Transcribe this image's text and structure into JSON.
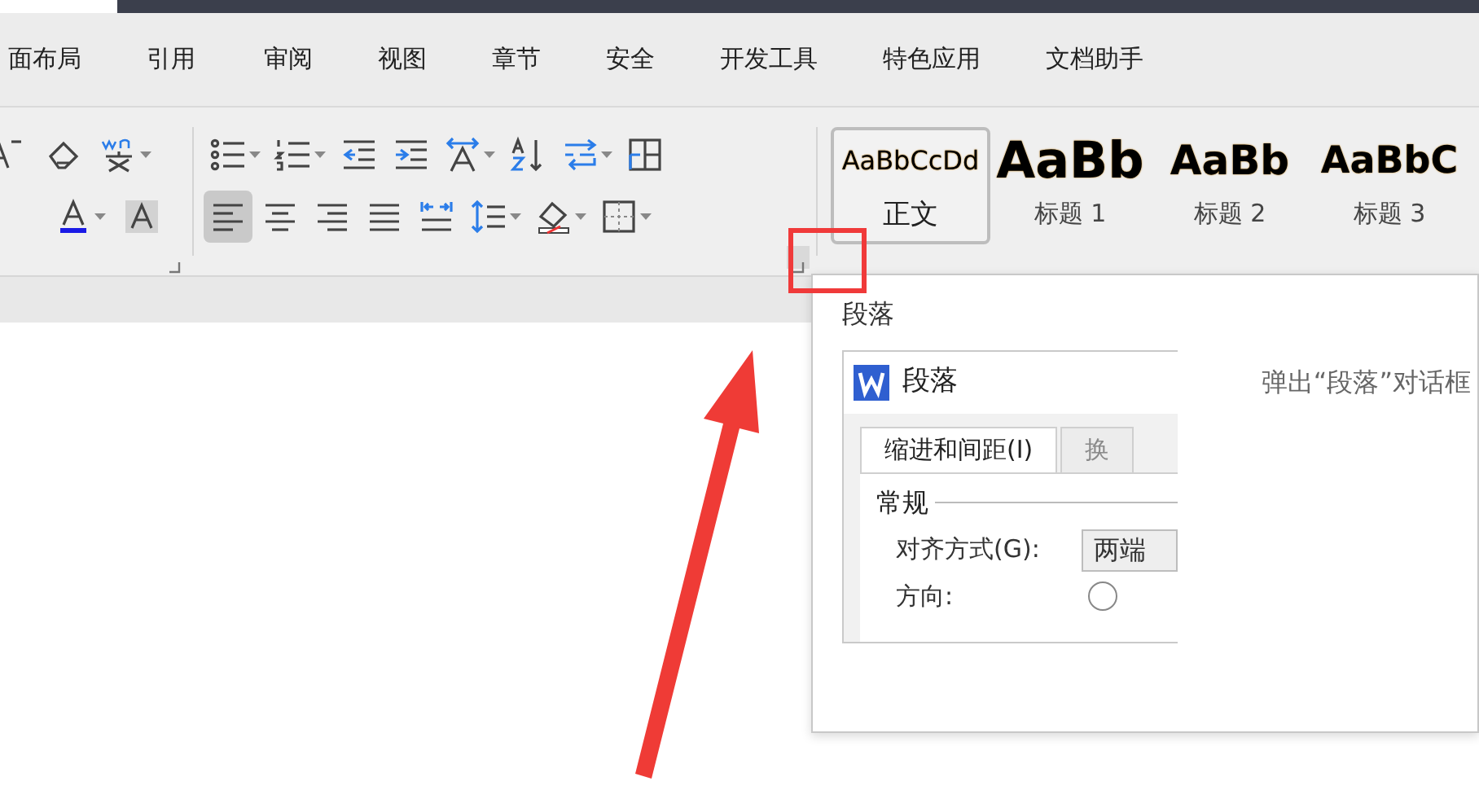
{
  "menu_tabs": [
    {
      "label": "面布局",
      "selected": false
    },
    {
      "label": "引用",
      "selected": false
    },
    {
      "label": "审阅",
      "selected": false
    },
    {
      "label": "视图",
      "selected": false
    },
    {
      "label": "章节",
      "selected": false
    },
    {
      "label": "安全",
      "selected": false
    },
    {
      "label": "开发工具",
      "selected": false
    },
    {
      "label": "特色应用",
      "selected": false
    },
    {
      "label": "文档助手",
      "selected": false
    }
  ],
  "font_group": {
    "row1": [
      {
        "kind": "grow-font",
        "pressed": false
      },
      {
        "kind": "clear-format",
        "pressed": false
      },
      {
        "kind": "pinyin",
        "pressed": false,
        "dropdown": true
      }
    ],
    "row2": [
      {
        "kind": "font-color",
        "pressed": false,
        "dropdown": true
      },
      {
        "kind": "char-shading",
        "pressed": false
      }
    ]
  },
  "paragraph_group": {
    "row1": [
      {
        "kind": "bullets",
        "pressed": false,
        "dropdown": true
      },
      {
        "kind": "numbering",
        "pressed": false,
        "dropdown": true
      },
      {
        "kind": "outdent",
        "pressed": false
      },
      {
        "kind": "indent",
        "pressed": false
      },
      {
        "kind": "text-direction",
        "pressed": false,
        "dropdown": true
      },
      {
        "kind": "sort",
        "pressed": false
      },
      {
        "kind": "convert",
        "pressed": false,
        "dropdown": true
      },
      {
        "kind": "table-grid",
        "pressed": false
      }
    ],
    "row2": [
      {
        "kind": "align-left",
        "pressed": true
      },
      {
        "kind": "align-center",
        "pressed": false
      },
      {
        "kind": "align-right",
        "pressed": false
      },
      {
        "kind": "justify",
        "pressed": false
      },
      {
        "kind": "distribute",
        "pressed": false
      },
      {
        "kind": "line-spacing",
        "pressed": false,
        "dropdown": true
      },
      {
        "kind": "shading",
        "pressed": false,
        "dropdown": true
      },
      {
        "kind": "borders",
        "pressed": false,
        "dropdown": true
      }
    ]
  },
  "styles": [
    {
      "kind": "body",
      "sample": "AaBbCcDd",
      "label": "正文",
      "selected": true
    },
    {
      "kind": "heading1",
      "sample": "AaBb",
      "label": "标题 1",
      "selected": false
    },
    {
      "kind": "heading2",
      "sample": "AaBb",
      "label": "标题 2",
      "selected": false
    },
    {
      "kind": "heading3",
      "sample": "AaBbC",
      "label": "标题 3",
      "selected": false
    }
  ],
  "tooltip": {
    "title": "段落",
    "description": "弹出“段落”对话框",
    "preview": {
      "dialog_title": "段落",
      "tabs": [
        {
          "label": "缩进和间距(I)",
          "selected": true
        },
        {
          "label": "换",
          "selected": false
        }
      ],
      "section": "常规",
      "fields": [
        {
          "kind": "select",
          "label": "对齐方式(G):",
          "value": "两端"
        },
        {
          "kind": "radio",
          "label": "方向:",
          "checked": false
        }
      ]
    }
  }
}
